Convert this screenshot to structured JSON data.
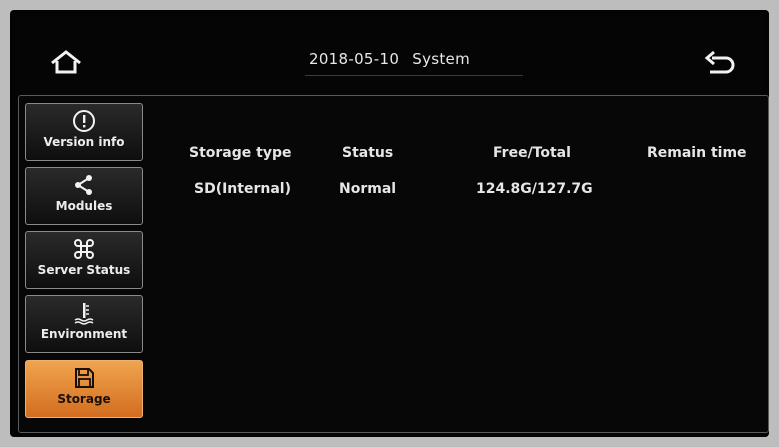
{
  "header": {
    "date": "2018-05-10",
    "title": "System"
  },
  "sidebar": {
    "items": [
      {
        "label": "Version info",
        "icon": "info-icon",
        "active": false
      },
      {
        "label": "Modules",
        "icon": "share-icon",
        "active": false
      },
      {
        "label": "Server Status",
        "icon": "command-icon",
        "active": false
      },
      {
        "label": "Environment",
        "icon": "temperature-icon",
        "active": false
      },
      {
        "label": "Storage",
        "icon": "floppy-disk-icon",
        "active": true
      }
    ]
  },
  "table": {
    "columns": [
      "Storage type",
      "Status",
      "Free/Total",
      "Remain time"
    ],
    "rows": [
      [
        "SD(Internal)",
        "Normal",
        "124.8G/127.7G",
        ""
      ]
    ]
  },
  "colors": {
    "active_tab": "#e8883a",
    "text": "#e6e6e6",
    "background": "#050505"
  }
}
